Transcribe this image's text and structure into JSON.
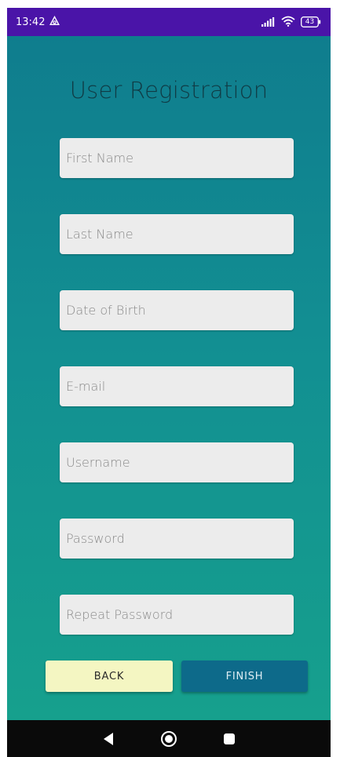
{
  "status_bar": {
    "time": "13:42",
    "battery": "43"
  },
  "page": {
    "title": "User Registration"
  },
  "form": {
    "fields": [
      {
        "placeholder": "First Name"
      },
      {
        "placeholder": "Last Name"
      },
      {
        "placeholder": "Date of Birth"
      },
      {
        "placeholder": "E-mail"
      },
      {
        "placeholder": "Username"
      },
      {
        "placeholder": "Password"
      },
      {
        "placeholder": "Repeat Password"
      }
    ],
    "back_label": "BACK",
    "finish_label": "FINISH"
  },
  "colors": {
    "status_bar": "#4a14a8",
    "gradient_top": "#0f7d8e",
    "gradient_bottom": "#16a08d",
    "back_button": "#f4f6c2",
    "finish_button": "#0d6a8a"
  },
  "icons": {
    "status_left": "cast-icon",
    "status_right": [
      "signal-icon",
      "wifi-icon",
      "battery-icon"
    ],
    "nav": [
      "back-triangle-icon",
      "home-circle-icon",
      "recents-square-icon"
    ]
  }
}
